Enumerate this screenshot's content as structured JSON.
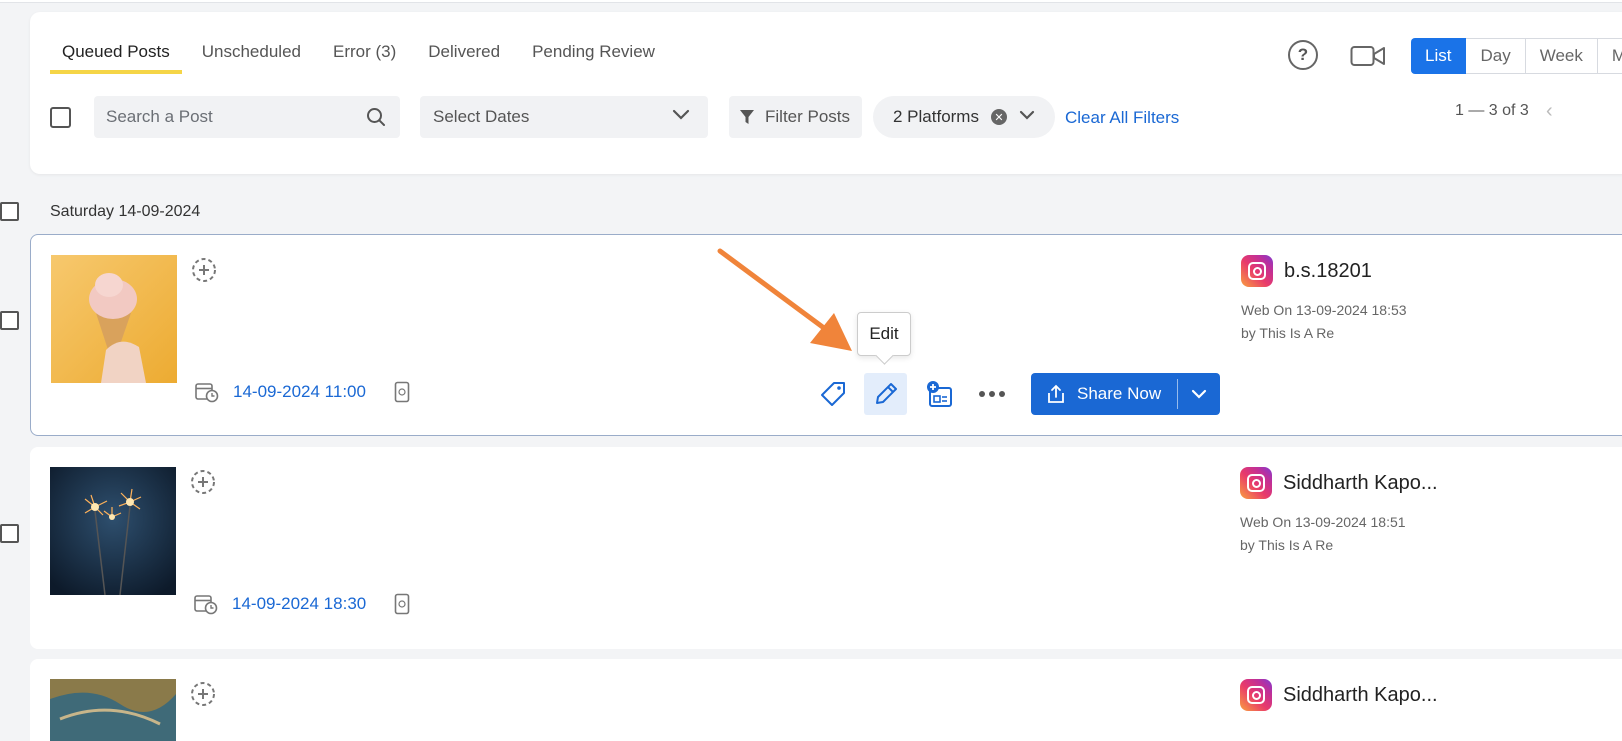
{
  "tabs": [
    {
      "label": "Queued Posts",
      "active": true
    },
    {
      "label": "Unscheduled",
      "active": false
    },
    {
      "label": "Error (3)",
      "active": false
    },
    {
      "label": "Delivered",
      "active": false
    },
    {
      "label": "Pending Review",
      "active": false
    }
  ],
  "help_label": "?",
  "view_modes": [
    "List",
    "Day",
    "Week",
    "Mor"
  ],
  "filters": {
    "search_placeholder": "Search a Post",
    "dates_label": "Select Dates",
    "filter_label": "Filter Posts",
    "platforms_label": "2 Platforms",
    "clear_label": "Clear All Filters"
  },
  "pagination": "1 — 3 of 3",
  "day_group": "Saturday 14-09-2024",
  "tooltip": "Edit",
  "share_label": "Share Now",
  "posts": [
    {
      "scheduled": "14-09-2024 11:00",
      "account": "b.s.18201",
      "meta1": "Web On 13-09-2024 18:53",
      "meta2": "by This Is A Re"
    },
    {
      "scheduled": "14-09-2024 18:30",
      "account": "Siddharth Kapo...",
      "meta1": "Web On 13-09-2024 18:51",
      "meta2": "by This Is A Re"
    },
    {
      "account": "Siddharth Kapo..."
    }
  ],
  "colors": {
    "accent": "#1a68d4",
    "tab_underline": "#f5d547",
    "annotation_arrow": "#f0843a"
  }
}
